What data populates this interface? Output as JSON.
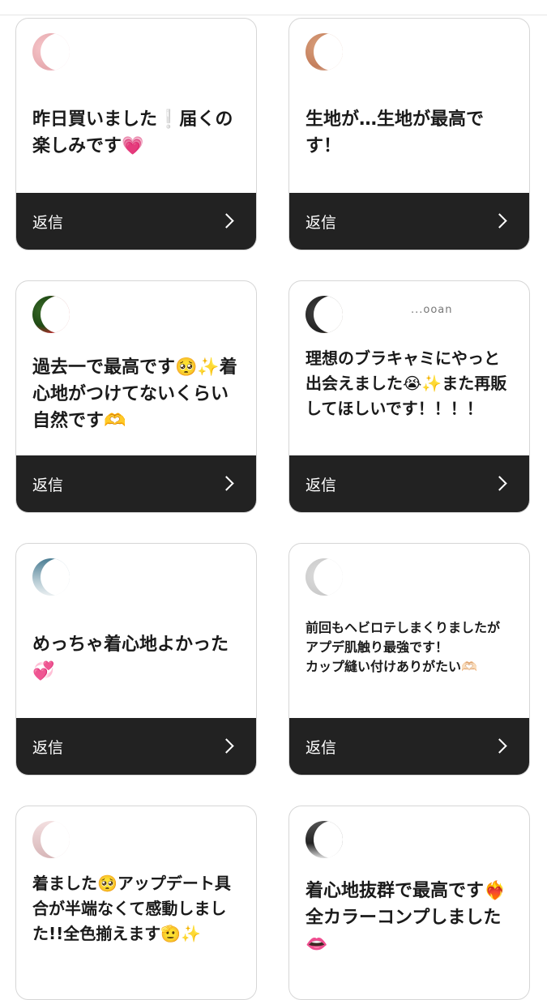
{
  "cards": [
    {
      "comment": "昨日買いました❕届くの楽しみです💗",
      "reply_label": "返信",
      "avatar_icon": "avatar-photo"
    },
    {
      "comment": "生地が…生地が最高です！",
      "reply_label": "返信",
      "avatar_icon": "avatar-photo"
    },
    {
      "comment": "過去一で最高です🥺✨着心地がつけてないくらい自然です🫶",
      "reply_label": "返信",
      "avatar_icon": "avatar-photo"
    },
    {
      "comment": "理想のブラキャミにやっと出会えました😭✨また再販してほしいです！！！！",
      "reply_label": "返信",
      "avatar_icon": "avatar-photo",
      "username": "...ooan"
    },
    {
      "comment": "めっちゃ着心地よかった💞",
      "reply_label": "返信",
      "avatar_icon": "avatar-photo"
    },
    {
      "comment": "前回もヘビロテしまくりましたが\nアプデ肌触り最強です！\nカップ縫い付けありがたい🫶🏻",
      "reply_label": "返信",
      "avatar_icon": "avatar-photo"
    },
    {
      "comment": "着ました🥺アップデート具合が半端なくて感動しました!!全色揃えます🫡✨",
      "avatar_icon": "avatar-photo"
    },
    {
      "comment": "着心地抜群で最高です❤️‍🔥全カラーコンプしました👄",
      "avatar_icon": "avatar-photo"
    }
  ]
}
